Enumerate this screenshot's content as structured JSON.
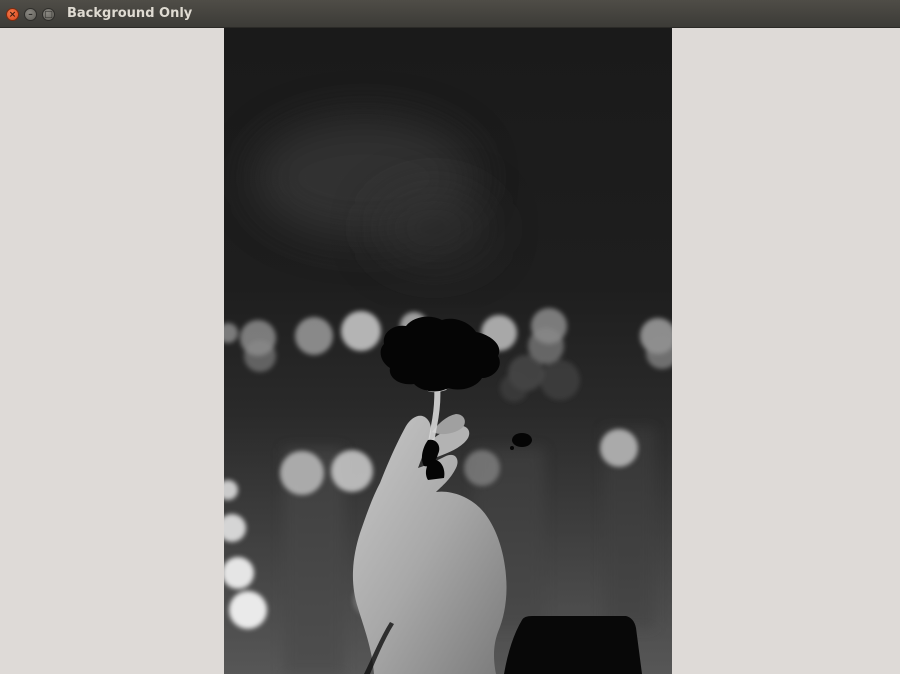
{
  "window": {
    "title": "Background Only",
    "controls": {
      "close": "close-icon",
      "minimize": "minimize-icon",
      "maximize": "maximize-icon"
    }
  },
  "image": {
    "description_icon": "photo-icon"
  }
}
